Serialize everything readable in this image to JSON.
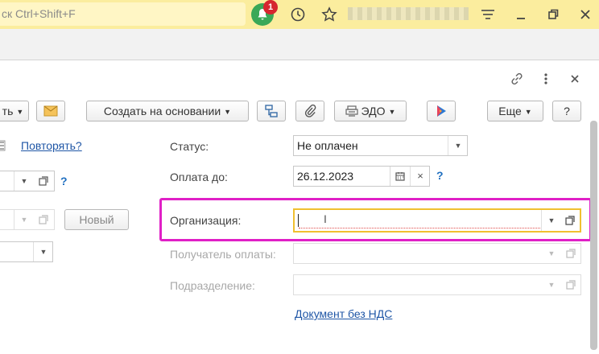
{
  "topbar": {
    "search_placeholder": "ск Ctrl+Shift+F",
    "notifications_count": "1",
    "icons": [
      "bell-icon",
      "history-icon",
      "star-icon",
      "menu-icon",
      "minimize-icon",
      "restore-icon",
      "close-icon"
    ]
  },
  "form_header": {
    "icons": [
      "link-icon",
      "more-icon",
      "close-icon"
    ]
  },
  "toolbar": {
    "partial_button_label": "ть",
    "create_based_on_label": "Создать на основании",
    "edo_label": "ЭДО",
    "more_label": "Еще",
    "help_label": "?"
  },
  "left": {
    "repeat_link": "Повторять?",
    "new_button": "Новый",
    "help_mark": "?"
  },
  "fields": {
    "status_label": "Статус:",
    "status_value": "Не оплачен",
    "pay_until_label": "Оплата до:",
    "pay_until_value": "26.12.2023",
    "organization_label": "Организация:",
    "organization_value": "",
    "recipient_label": "Получатель оплаты:",
    "division_label": "Подразделение:",
    "no_vat_link": "Документ без НДС",
    "help_mark": "?"
  },
  "colors": {
    "highlight": "#e020c6",
    "link": "#1f56a6",
    "topbar": "#fbed9e",
    "focus": "#f0c030"
  }
}
